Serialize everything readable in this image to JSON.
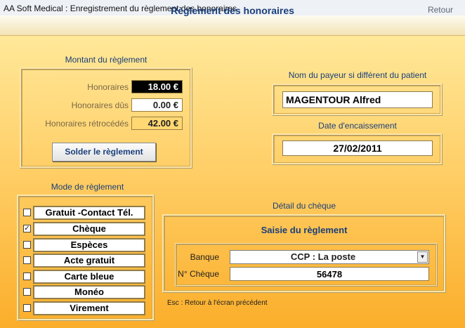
{
  "window": {
    "title": "AA Soft Medical : Enregistrement du règlement des honoraires"
  },
  "header": {
    "title": "Règlement des honoraires",
    "back_label": "Retour"
  },
  "montant": {
    "section_title": "Montant du règlement",
    "fields": [
      {
        "label": "Honoraires",
        "value": "18.00 €"
      },
      {
        "label": "Honoraires dûs",
        "value": "0.00 €"
      },
      {
        "label": "Honoraires rétrocédés",
        "value": "42.00 €"
      }
    ],
    "solder_button": "Solder le règlement"
  },
  "payeur": {
    "section_title": "Nom du payeur si différent du patient",
    "value": "MAGENTOUR Alfred"
  },
  "encaissement": {
    "section_title": "Date d'encaissement",
    "value": "27/02/2011"
  },
  "mode": {
    "section_title": "Mode de règlement",
    "options": [
      {
        "label": "Gratuit -Contact Tél.",
        "checked": false
      },
      {
        "label": "Chèque",
        "checked": true
      },
      {
        "label": "Espèces",
        "checked": false
      },
      {
        "label": "Acte gratuit",
        "checked": false
      },
      {
        "label": "Carte bleue",
        "checked": false
      },
      {
        "label": "Monéo",
        "checked": false
      },
      {
        "label": "Virement",
        "checked": false
      }
    ]
  },
  "cheque": {
    "section_title": "Détail du chèque",
    "panel_title": "Saisie du règlement",
    "banque_label": "Banque",
    "banque_value": "CCP : La poste",
    "numero_label": "N° Chèque",
    "numero_value": "56478"
  },
  "footer": {
    "esc_note": "Esc : Retour à l'écran précédent"
  }
}
